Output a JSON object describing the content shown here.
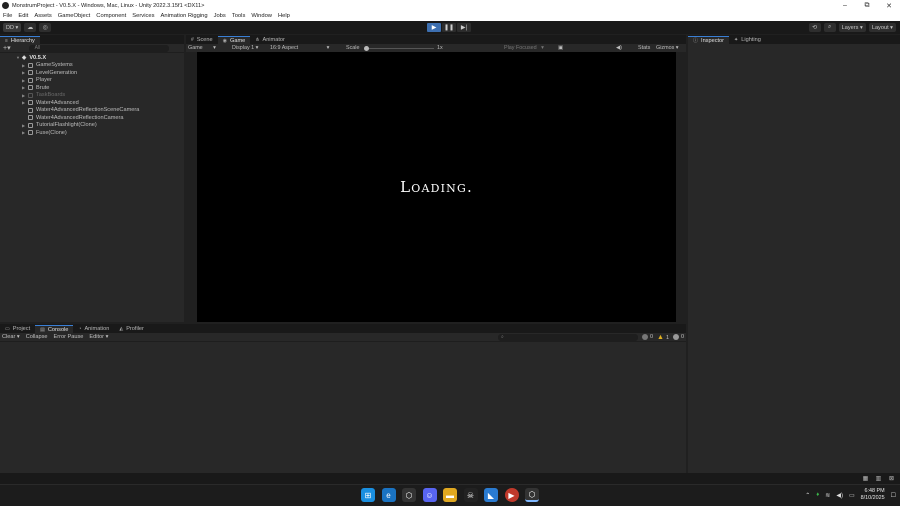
{
  "window": {
    "title": "MonstrumProject - V0.5.X - Windows, Mac, Linux - Unity 2022.3.15f1 <DX11>",
    "buttons": [
      "–",
      "⧉",
      "✕"
    ]
  },
  "menu": [
    "File",
    "Edit",
    "Assets",
    "GameObject",
    "Component",
    "Services",
    "Animation Rigging",
    "Jobs",
    "Tools",
    "Window",
    "Help"
  ],
  "toolbar": {
    "account": "DD ▾",
    "layers": "Layers",
    "layout": "Layout"
  },
  "hierarchy": {
    "tab": "Hierarchy",
    "search_placeholder": "All",
    "root": "V0.5.X",
    "items": [
      {
        "label": "GameSystems",
        "dim": false
      },
      {
        "label": "LevelGeneration",
        "dim": false
      },
      {
        "label": "Player",
        "dim": false
      },
      {
        "label": "Brute",
        "dim": false
      },
      {
        "label": "TaskBoards",
        "dim": true
      },
      {
        "label": "Water4Advanced",
        "dim": false
      },
      {
        "label": "Water4AdvancedReflectionSceneCamera",
        "dim": false
      },
      {
        "label": "Water4AdvancedReflectionCamera",
        "dim": false
      },
      {
        "label": "TutorialFlashlight(Clone)",
        "dim": false
      },
      {
        "label": "Fuse(Clone)",
        "dim": false
      }
    ]
  },
  "game_view": {
    "tabs": [
      "Scene",
      "Game",
      "Animator"
    ],
    "mode": "Game",
    "display": "Display 1",
    "aspect": "16:9 Aspect",
    "scale_label": "Scale",
    "scale_value": "1x",
    "play_focused": "Play Focused",
    "stats": "Stats",
    "gizmos": "Gizmos",
    "loading_text": "Loading."
  },
  "inspector": {
    "tabs": [
      "Inspector",
      "Lighting"
    ]
  },
  "console": {
    "tabs": [
      "Project",
      "Console",
      "Animation",
      "Profiler"
    ],
    "clear": "Clear",
    "collapse": "Collapse",
    "error_pause": "Error Pause",
    "editor": "Editor",
    "log_count": "0",
    "warn_count": "1",
    "error_count": "0"
  },
  "taskbar": {
    "clock_time": "6:48 PM",
    "clock_date": "8/10/2025"
  },
  "colors": {
    "accent": "#3a7fd5",
    "play_active": "#3d6fb0",
    "panel_bg": "#282828",
    "dark_bg": "#191919",
    "warning": "#e0b020"
  }
}
